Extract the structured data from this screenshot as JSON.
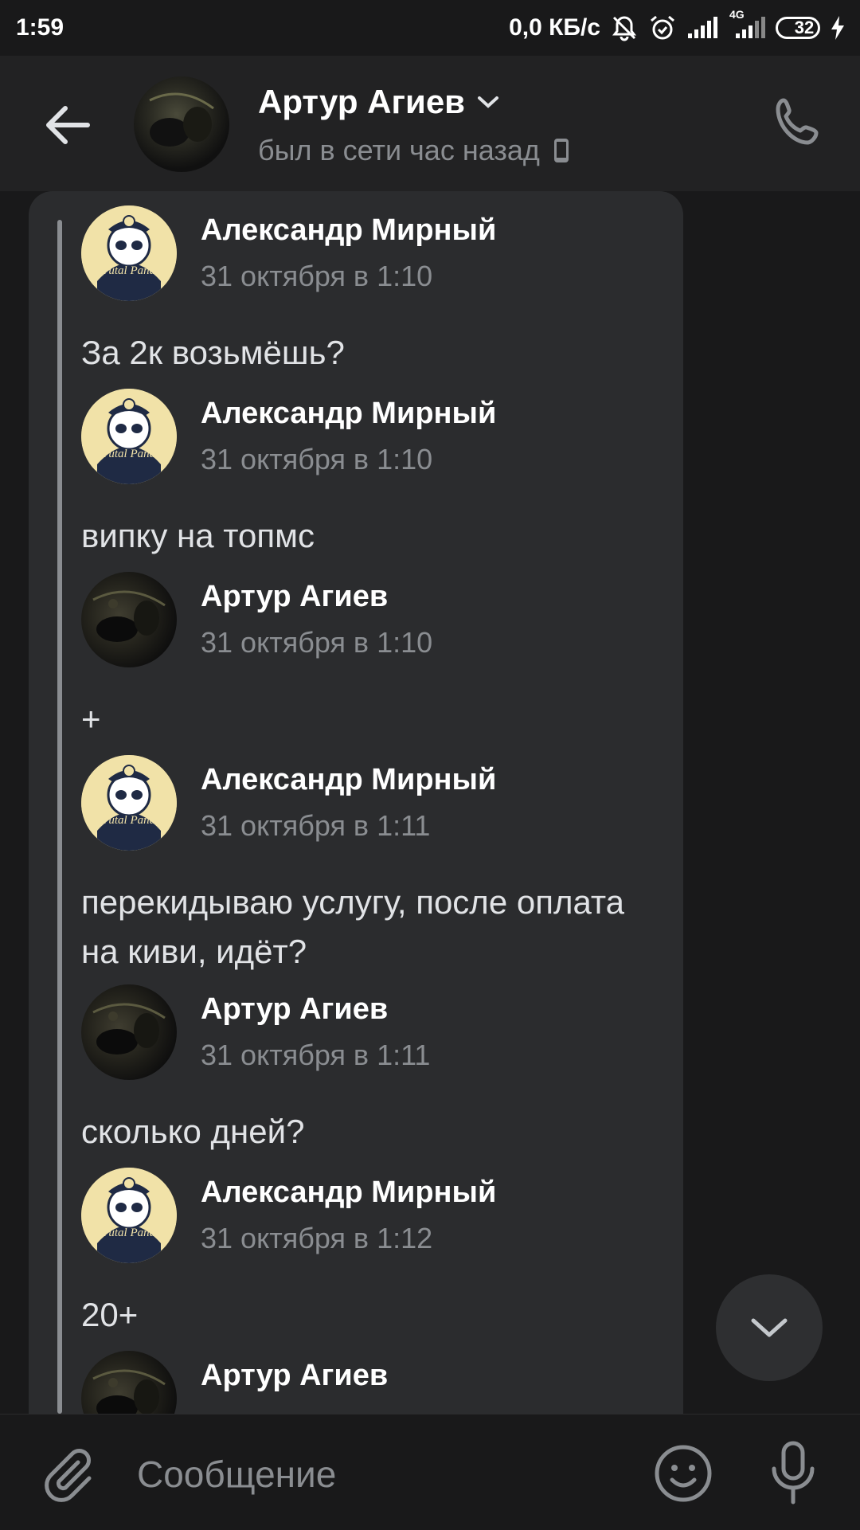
{
  "status_bar": {
    "time": "1:59",
    "network_speed": "0,0 КБ/с",
    "network_type": "4G",
    "battery_level": "32",
    "icons": [
      "mute-notifications-icon",
      "alarm-icon",
      "signal-icon",
      "signal-4g-icon",
      "battery-icon",
      "charging-icon"
    ]
  },
  "header": {
    "contact_name": "Артур Агиев",
    "last_seen": "был в сети час назад",
    "icons": [
      "back-arrow-icon",
      "chevron-down-icon",
      "mobile-device-icon",
      "phone-icon"
    ]
  },
  "forwarded_messages": [
    {
      "author": "Александр Мирный",
      "time": "31 октября в 1:10",
      "text": "За 2к возьмёшь?",
      "avatar": "panda"
    },
    {
      "author": "Александр Мирный",
      "time": "31 октября в 1:10",
      "text": "випку на топмс",
      "avatar": "panda"
    },
    {
      "author": "Артур Агиев",
      "time": "31 октября в 1:10",
      "text": "+",
      "avatar": "dark"
    },
    {
      "author": "Александр Мирный",
      "time": "31 октября в 1:11",
      "text": "перекидываю услугу, после оплата на киви, идёт?",
      "avatar": "panda"
    },
    {
      "author": "Артур Агиев",
      "time": "31 октября в 1:11",
      "text": "сколько дней?",
      "avatar": "dark"
    },
    {
      "author": "Александр Мирный",
      "time": "31 октября в 1:12",
      "text": "20+",
      "avatar": "panda"
    },
    {
      "author": "Артур Агиев",
      "time": "",
      "text": "",
      "avatar": "dark"
    }
  ],
  "panda_avatar_text": "Brutal Panda",
  "composer": {
    "placeholder": "Сообщение",
    "icons": [
      "attach-icon",
      "emoji-icon",
      "microphone-icon"
    ]
  },
  "scroll_button": {
    "icon": "chevron-down-icon"
  },
  "colors": {
    "background": "#19191a",
    "header": "#222223",
    "bubble": "#2b2c2e",
    "secondary_text": "#8a8d91",
    "primary_text": "#e1e3e6",
    "battery": "#4caf50"
  }
}
